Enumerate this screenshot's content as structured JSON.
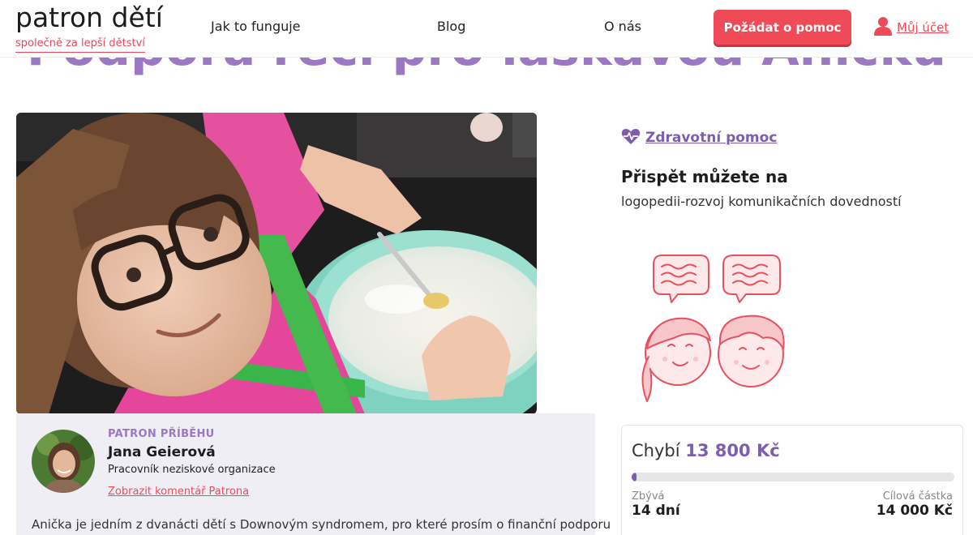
{
  "page": {
    "background_title": "Podpora řečí pro laskavou Aničku"
  },
  "header": {
    "logo_name": "patron dětí",
    "logo_tagline": "společně za lepší dětství",
    "nav": [
      "Jak to funguje",
      "Blog",
      "O nás"
    ],
    "cta_label": "Požádat o pomoc",
    "account_label": "Můj účet",
    "account_icon": "user-icon"
  },
  "hero": {
    "image_desc": "child-baking-photo"
  },
  "patron": {
    "kicker": "PATRON PŘÍBĚHU",
    "name": "Jana Geierová",
    "role": "Pracovník neziskové organizace",
    "link": "Zobrazit komentář Patrona",
    "story": "Anička je jedním z dvanácti dětí s Downovým syndromem, pro které prosím o finanční podporu"
  },
  "sidebar": {
    "category_icon": "heart-pulse-icon",
    "category_label": "Zdravotní pomoc",
    "contrib_heading": "Přispět můžete na",
    "contrib_text": "logopedii-rozvoj komunikačních dovedností"
  },
  "donation": {
    "missing_label": "Chybí",
    "missing_amount": "13 800 Kč",
    "progress_fraction": 0.014,
    "remaining_label": "Zbývá",
    "remaining_value": "14 dní",
    "target_label": "Cílová částka",
    "target_value": "14 000 Kč"
  },
  "colors": {
    "accent_red": "#ee4a58",
    "accent_purple": "#7c5db0",
    "title_purple": "#9b77c4",
    "panel_bg": "#f0eef5"
  }
}
